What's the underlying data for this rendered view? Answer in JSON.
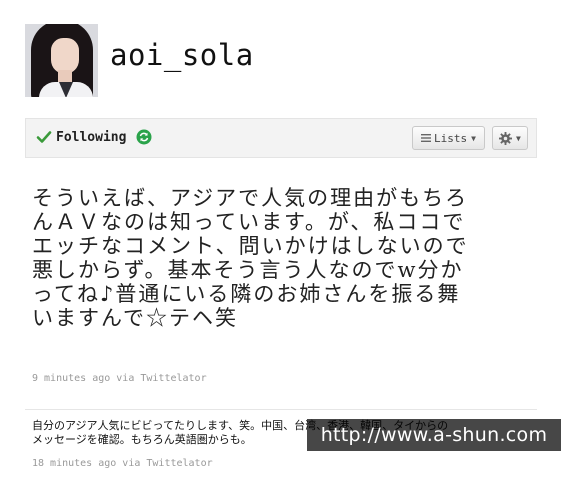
{
  "profile": {
    "screen_name": "aoi_sola"
  },
  "actions": {
    "following_label": "Following",
    "lists_label": "Lists",
    "icons": {
      "following": "check-icon",
      "refresh": "refresh-icon",
      "lists": "lines-icon",
      "settings": "gear-icon"
    },
    "colors": {
      "check": "#3a9a3a",
      "refresh": "#2aa34a"
    }
  },
  "tweets": [
    {
      "text": "そういえば、アジアで人気の理由がもちろんＡＶなのは知っています。が、私ココでエッチなコメント、問いかけはしないので悪しからず。基本そう言う人なのでw分かってね♪普通にいる隣のお姉さんを振る舞いますんで☆テヘ笑",
      "meta": "9 minutes ago via Twittelator"
    },
    {
      "text": "自分のアジア人気にビビってたりします、笑。中国、台湾、香港、韓国、タイからのメッセージを確認。もちろん英語圏からも。",
      "meta": "18 minutes ago via Twittelator"
    }
  ],
  "watermark": "http://www.a-shun.com"
}
